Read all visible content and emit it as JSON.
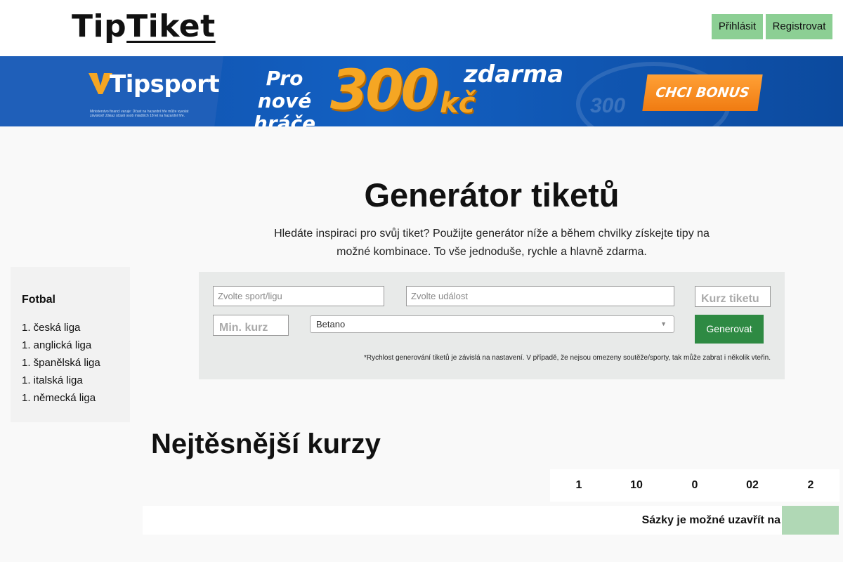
{
  "header": {
    "logo_part1": "Tip",
    "logo_part2": "Tiket",
    "login_label": "Přihlásit",
    "register_label": "Registrovat"
  },
  "banner": {
    "brand": "Tipsport",
    "warning": "Ministerstvo financí varuje: Účast na hazardní hře může vyvolat závislost! Zákaz účasti osob mladších 18 let na hazardní hře.",
    "promo_line1": "Pro nové",
    "promo_line2": "hráče",
    "amount": "300",
    "currency": "kč",
    "free": "zdarma",
    "coin_text": "300",
    "cta_label": "CHCI BONUS"
  },
  "sidebar": {
    "title": "Fotbal",
    "items": [
      "1. česká liga",
      "1. anglická liga",
      "1. španělská liga",
      "1. italská liga",
      "1. německá liga"
    ]
  },
  "generator": {
    "title": "Generátor tiketů",
    "subtitle": "Hledáte inspiraci pro svůj tiket? Použijte generátor níže a během chvilky získejte tipy na možné kombinace. To vše jednoduše, rychle a hlavně zdarma.",
    "sport_placeholder": "Zvolte sport/ligu",
    "event_placeholder": "Zvolte událost",
    "ticket_odds_placeholder": "Kurz tiketu",
    "min_odds_placeholder": "Min. kurz",
    "bookmaker_selected": "Betano",
    "generate_label": "Generovat",
    "note": "*Rychlost generování tiketů je závislá na nastavení. V případě, že nejsou omezeny soutěže/sporty, tak může zabrat i několik vteřin."
  },
  "odds": {
    "title": "Nejtěsnější kurzy",
    "headers": [
      "1",
      "10",
      "0",
      "02",
      "2"
    ],
    "row_label": "Sázky je možné uzavřít na"
  }
}
